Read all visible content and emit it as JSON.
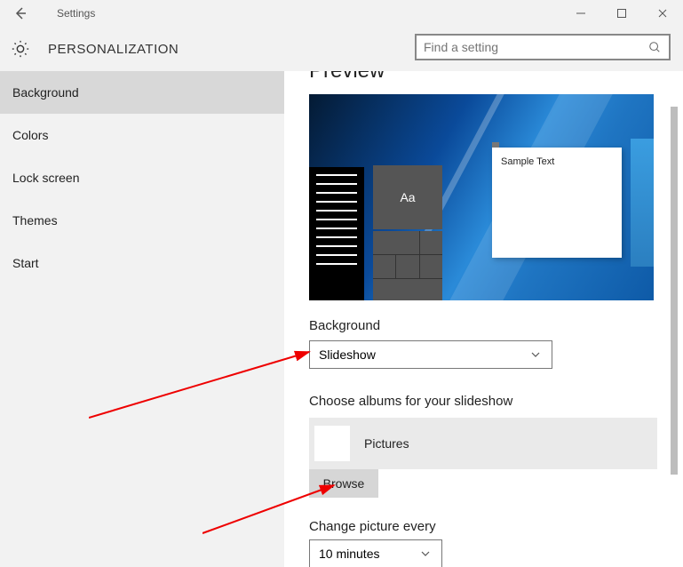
{
  "titlebar": {
    "title": "Settings"
  },
  "header": {
    "title": "PERSONALIZATION"
  },
  "search": {
    "placeholder": "Find a setting"
  },
  "sidebar": {
    "items": [
      {
        "label": "Background",
        "active": true
      },
      {
        "label": "Colors"
      },
      {
        "label": "Lock screen"
      },
      {
        "label": "Themes"
      },
      {
        "label": "Start"
      }
    ]
  },
  "main": {
    "preview_label": "Preview",
    "sample_text": "Sample Text",
    "aa_label": "Aa",
    "background_label": "Background",
    "background_value": "Slideshow",
    "choose_albums_label": "Choose albums for your slideshow",
    "album_name": "Pictures",
    "browse_label": "Browse",
    "change_every_label": "Change picture every",
    "change_every_value": "10 minutes"
  }
}
